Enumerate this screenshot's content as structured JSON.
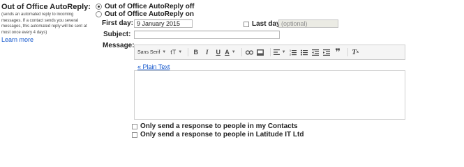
{
  "left": {
    "title": "Out of Office AutoReply:",
    "description": "(sends an automated reply to incoming messages. If a contact sends you several messages, this automated reply will be sent at most once every 4 days)",
    "learn_more": "Learn more"
  },
  "autoreply": {
    "off_label": "Out of Office AutoReply off",
    "on_label": "Out of Office AutoReply on",
    "selected": "off"
  },
  "first_day": {
    "label": "First day:",
    "value": "9 January 2015"
  },
  "last_day": {
    "label": "Last day:",
    "placeholder": "(optional)",
    "checked": false
  },
  "subject": {
    "label": "Subject:",
    "value": ""
  },
  "message": {
    "label": "Message:"
  },
  "toolbar": {
    "font_name": "Sans Serif",
    "size_icon": "tT",
    "bold": "B",
    "italic": "I",
    "underline": "U",
    "text_color": "A",
    "icons": [
      "font-dropdown",
      "font-size-icon",
      "bold-icon",
      "italic-icon",
      "underline-icon",
      "text-color-icon",
      "link-icon",
      "image-icon",
      "align-icon",
      "numbered-list-icon",
      "bulleted-list-icon",
      "indent-less-icon",
      "indent-more-icon",
      "quote-icon",
      "remove-formatting-icon"
    ]
  },
  "plain_text_link": "« Plain Text",
  "options": {
    "contacts_only": "Only send a response to people in my Contacts",
    "domain_only": "Only send a response to people in Latitude IT Ltd"
  },
  "colors": {
    "link": "#1155cc",
    "disabled_bg": "#ebebe4"
  }
}
